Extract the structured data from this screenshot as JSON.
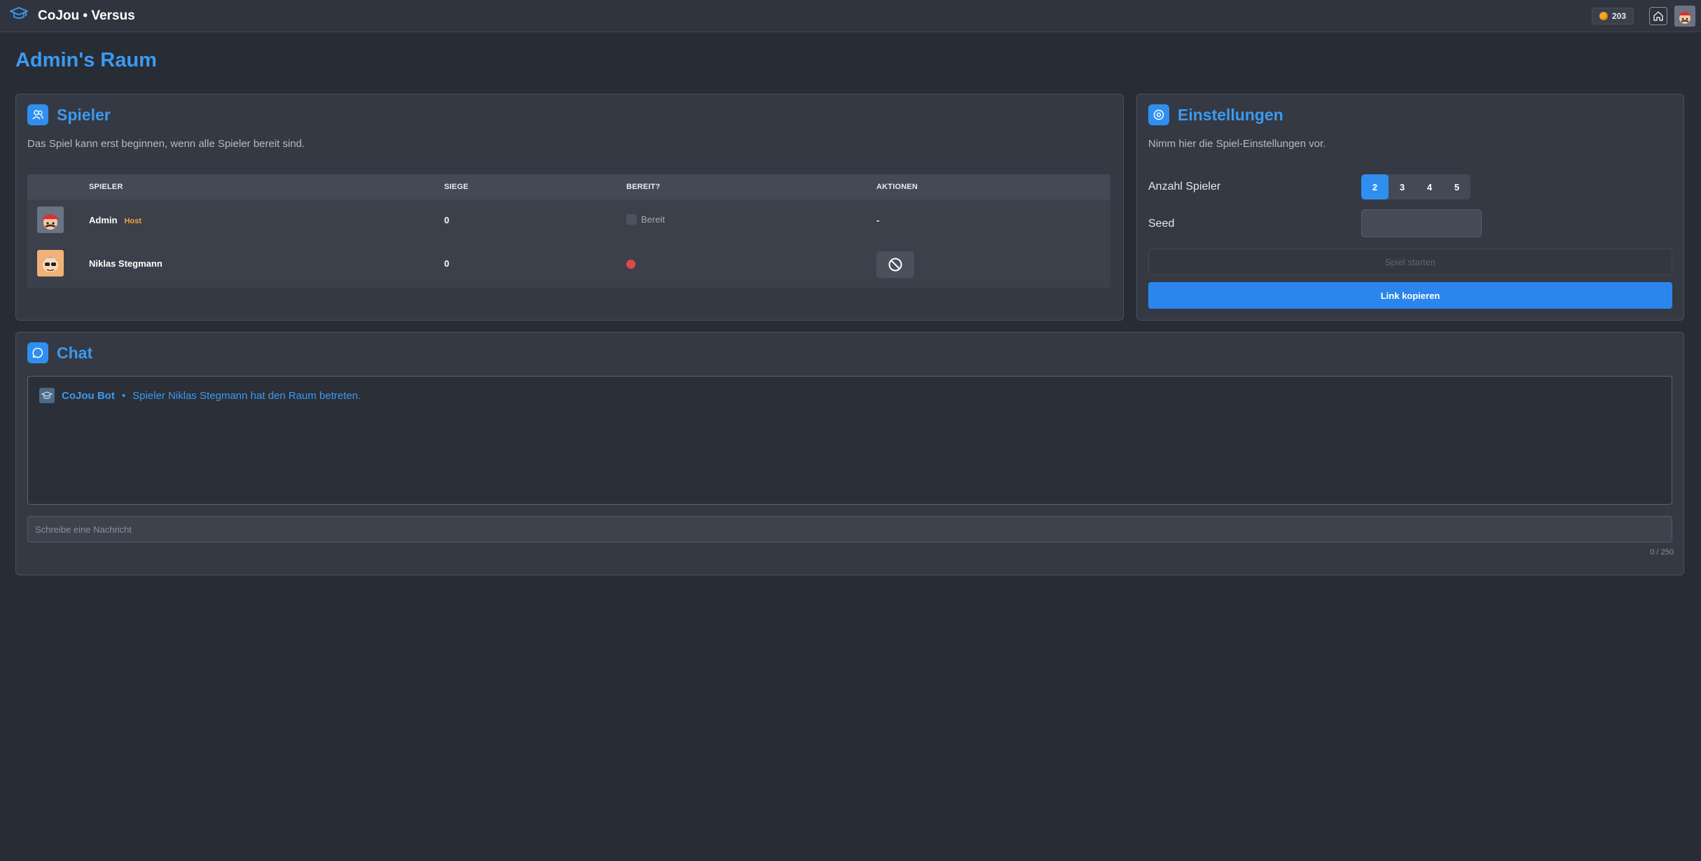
{
  "app": {
    "title": "CoJou • Versus",
    "coins": "203"
  },
  "page": {
    "title": "Admin's Raum"
  },
  "players_panel": {
    "title": "Spieler",
    "description": "Das Spiel kann erst beginnen, wenn alle Spieler bereit sind.",
    "columns": [
      "SPIELER",
      "SIEGE",
      "BEREIT?",
      "AKTIONEN"
    ],
    "rows": [
      {
        "name": "Admin",
        "tag": "Host",
        "wins": "0",
        "ready_label": "Bereit",
        "action": "-"
      },
      {
        "name": "Niklas Stegmann",
        "tag": "",
        "wins": "0",
        "ready_label": "",
        "action": ""
      }
    ]
  },
  "settings_panel": {
    "title": "Einstellungen",
    "description": "Nimm hier die Spiel-Einstellungen vor.",
    "player_count_label": "Anzahl Spieler",
    "player_count_options": [
      "2",
      "3",
      "4",
      "5"
    ],
    "player_count_selected": "2",
    "seed_label": "Seed",
    "seed_value": "",
    "start_button": "Spiel starten",
    "copy_button": "Link kopieren"
  },
  "chat_panel": {
    "title": "Chat",
    "messages": [
      {
        "sender": "CoJou Bot",
        "separator": "•",
        "text": "Spieler Niklas Stegmann hat den Raum betreten."
      }
    ],
    "input_placeholder": "Schreibe eine Nachricht",
    "char_count": "0 / 250"
  },
  "colors": {
    "accent": "#3b9af0",
    "host": "#f0a63b",
    "not_ready": "#e04848",
    "background": "#282c35"
  }
}
